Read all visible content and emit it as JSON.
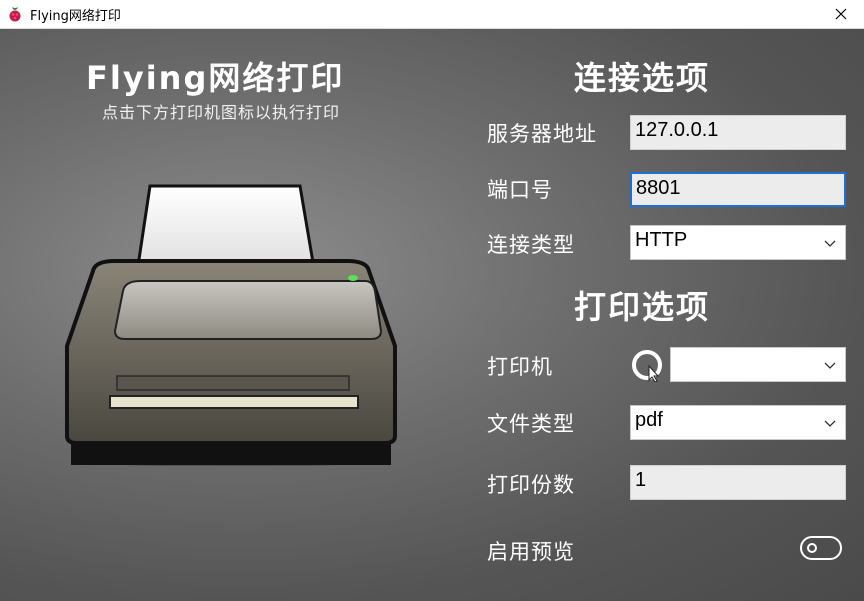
{
  "window": {
    "title": "Flying网络打印"
  },
  "header": {
    "title": "Flying网络打印",
    "subtitle": "点击下方打印机图标以执行打印"
  },
  "connection": {
    "section_title": "连接选项",
    "server_label": "服务器地址",
    "server_value": "127.0.0.1",
    "port_label": "端口号",
    "port_value": "8801",
    "type_label": "连接类型",
    "type_value": "HTTP"
  },
  "print": {
    "section_title": "打印选项",
    "printer_label": "打印机",
    "printer_value": "",
    "filetype_label": "文件类型",
    "filetype_value": "pdf",
    "copies_label": "打印份数",
    "copies_value": "1",
    "preview_label": "启用预览",
    "preview_enabled": false
  },
  "colors": {
    "focus_border": "#1e6fd6",
    "led": "#5ce05c"
  }
}
